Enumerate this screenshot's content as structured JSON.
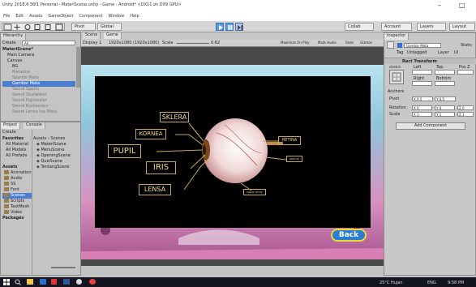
{
  "window": {
    "title": "Unity 2018.4.36f1 Personal - MateriScene.unity - Game - Android* <DX11 on DX9 GPU>",
    "min_icon": "minimize-icon",
    "max_icon": "maximize-icon",
    "minimize_glyph": "–",
    "maximize_glyph": "□"
  },
  "menu": [
    "File",
    "Edit",
    "Assets",
    "GameObject",
    "Component",
    "Window",
    "Help"
  ],
  "toolbar": {
    "pivot": "Pivot",
    "global": "Global",
    "collab": "Collab",
    "account": "Account",
    "layers": "Layers",
    "layout": "Layout"
  },
  "hierarchy": {
    "tab": "Hierarchy",
    "create": "Create",
    "search": "All",
    "scene": "MateriScene*",
    "items": [
      "Main Camera",
      "Canvas",
      "BG",
      "Matadua",
      "Sparkle Mata",
      "Gambar Mata",
      "Sword Sperlu",
      "Sword Skullweler",
      "Sword Pupilweler",
      "Sword Kuslwerers",
      "Sword Lensa Ina Mata"
    ]
  },
  "project": {
    "tabs": [
      "Project",
      "Console"
    ],
    "create": "Create",
    "breadcrumb": [
      "Assets",
      "Scenes"
    ],
    "favorites_label": "Favorites",
    "favorites": [
      "All Material",
      "All Models",
      "All Prefabs"
    ],
    "assets_label": "Assets",
    "folders": [
      "Animation",
      "Audio",
      "SS",
      "Font",
      "Scenes",
      "Scripts",
      "TextMesh",
      "Video"
    ],
    "packages_label": "Packages",
    "files": [
      "MateriScene",
      "MenuScene",
      "OpeningScene",
      "QuizScene",
      "TentangScene"
    ]
  },
  "center": {
    "tabs": [
      "Scene",
      "Game"
    ],
    "display": "Display 1",
    "aspect": "1920x1080 (1920x1080)",
    "scale_label": "Scale",
    "scale_value": "0.62",
    "right_controls": [
      "Maximize On Play",
      "Mute Audio",
      "Stats",
      "Gizmos"
    ]
  },
  "game": {
    "labels": [
      "SKLERA",
      "KORNEA",
      "PUPIL",
      "IRIS",
      "LENSA",
      "RETINA",
      "KOROID",
      "SARAF OPTIK"
    ],
    "back_button": "Back"
  },
  "inspector": {
    "tab": "Inspector",
    "object_name": "Gambar Mata",
    "static_label": "Static",
    "tag_label": "Tag",
    "tag_value": "Untagged",
    "layer_label": "Layer",
    "layer_value": "UI",
    "component": "Rect Transform",
    "stretch": "stretch",
    "col_headers": [
      "Left",
      "Top",
      "Pos Z"
    ],
    "col_headers2": [
      "Right",
      "Bottom"
    ],
    "anchors": "Anchors",
    "pivot_label": "Pivot",
    "pivot_values": [
      "X 0.5",
      "Y 0.5"
    ],
    "rotation_label": "Rotation",
    "rotation_values": [
      "X 0",
      "Y 0",
      "Z 0"
    ],
    "scale_label": "Scale",
    "scale_values": [
      "X 1",
      "Y 1",
      "Z 1"
    ],
    "add_component": "Add Component"
  },
  "taskbar": {
    "weather": "25°C Hujan",
    "language": "ENG",
    "time": "9:58 PM"
  }
}
